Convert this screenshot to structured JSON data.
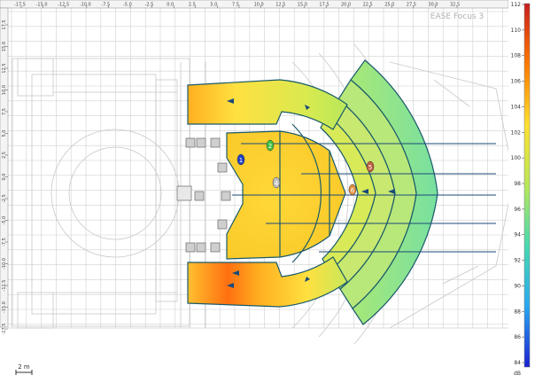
{
  "app": {
    "watermark": "EASE Focus 3"
  },
  "top_ruler": {
    "ticks": [
      "-17.5",
      "-15.0",
      "-12.5",
      "-10.0",
      "-7.5",
      "-5.0",
      "-2.5",
      "0.0",
      "2.5",
      "5.0",
      "7.5",
      "10.0",
      "12.5",
      "15.0",
      "17.5",
      "20.0",
      "22.5",
      "25.0",
      "27.5",
      "30.0",
      "32.5"
    ]
  },
  "left_ruler": {
    "ticks": [
      "17.5",
      "15.0",
      "12.5",
      "10.0",
      "7.5",
      "5.0",
      "2.5",
      "0.0",
      "-2.5",
      "-5.0",
      "-7.5",
      "-10.0",
      "-12.5",
      "-15.0",
      "-17.5"
    ]
  },
  "scale_bar": {
    "label": "2 m"
  },
  "color_scale": {
    "unit": "dB",
    "min": 84,
    "max": 112,
    "ticks": [
      "112",
      "110",
      "108",
      "106",
      "104",
      "102",
      "100",
      "98",
      "96",
      "94",
      "92",
      "90",
      "88",
      "86",
      "84"
    ],
    "colors": [
      "#c81e1e",
      "#ff7a00",
      "#ffe030",
      "#b8e85a",
      "#48d8b0",
      "#2aa8f0",
      "#1a20d0"
    ]
  },
  "loudspeakers": [
    {
      "label": "1",
      "color": "#2040c0"
    },
    {
      "label": "2",
      "color": "#40c040"
    },
    {
      "label": "4",
      "color": "#c0c0c0"
    },
    {
      "label": "5",
      "color": "#c06040"
    },
    {
      "label": "6",
      "color": "#e09040"
    }
  ]
}
